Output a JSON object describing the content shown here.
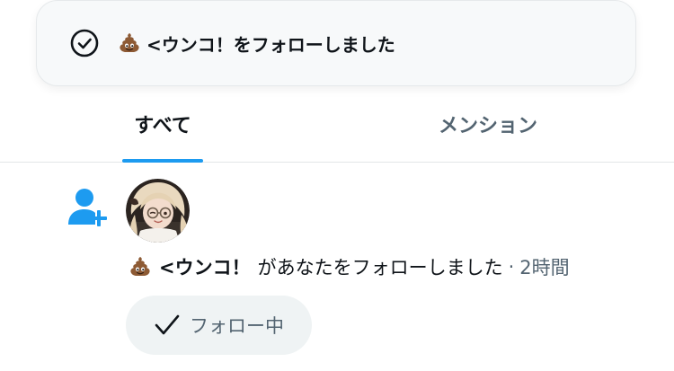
{
  "toast": {
    "icon": "check-circle-icon",
    "emoji": "poop-emoji",
    "message": "<ウンコ！をフォローしました"
  },
  "tabs": {
    "all_label": "すべて",
    "mentions_label": "メンション",
    "active": "すべて"
  },
  "notification": {
    "type_icon": "person-add-icon",
    "user_emoji": "poop-emoji",
    "user_name": "<ウンコ！",
    "action": "があなたをフォローしました",
    "separator": "·",
    "time": "2時間",
    "follow_button_label": "フォロー中",
    "follow_button_icon": "checkmark-icon"
  },
  "colors": {
    "accent": "#1d9bf0",
    "text_primary": "#0f1419",
    "text_secondary": "#536471",
    "button_bg": "#eff3f4",
    "toast_bg": "#f7f9fa"
  }
}
